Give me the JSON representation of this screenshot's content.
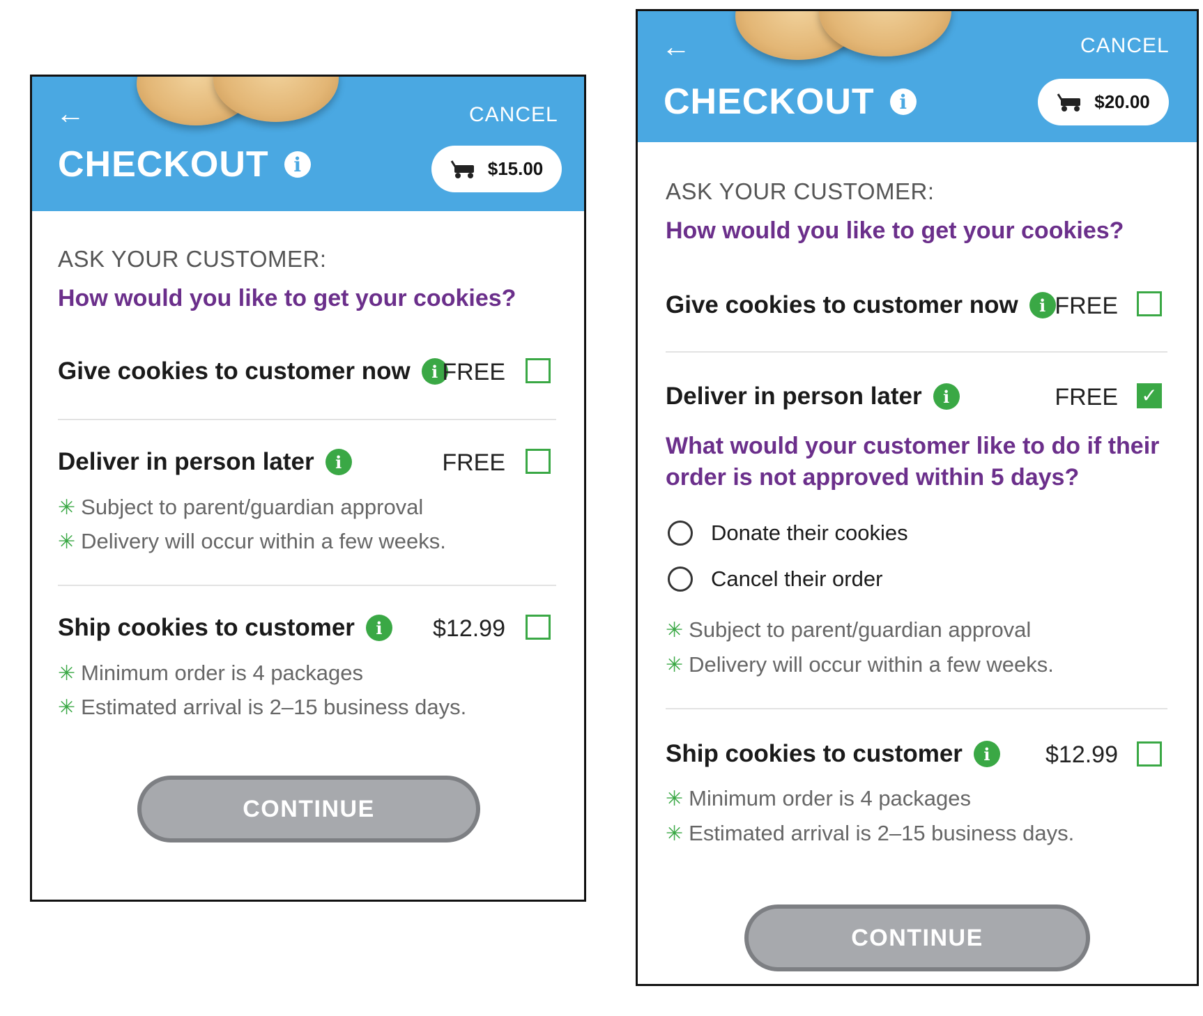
{
  "screens": [
    {
      "header": {
        "back_icon": "arrow-left-icon",
        "cancel_label": "CANCEL",
        "title": "CHECKOUT",
        "info_icon": "info-icon",
        "cart_icon": "wagon-cart-icon",
        "cart_total": "$15.00"
      },
      "ask_label": "ASK YOUR CUSTOMER:",
      "question": "How would you like to get your cookies?",
      "options": [
        {
          "label": "Give cookies to customer now",
          "price": "FREE",
          "checked": false
        },
        {
          "label": "Deliver in person later",
          "price": "FREE",
          "checked": false,
          "notes": [
            "Subject to parent/guardian approval",
            "Delivery will occur within a few weeks."
          ]
        },
        {
          "label": "Ship cookies to customer",
          "price": "$12.99",
          "checked": false,
          "notes": [
            "Minimum order is 4 packages",
            "Estimated arrival is 2–15 business days."
          ]
        }
      ],
      "continue_label": "CONTINUE"
    },
    {
      "header": {
        "back_icon": "arrow-left-icon",
        "cancel_label": "CANCEL",
        "title": "CHECKOUT",
        "info_icon": "info-icon",
        "cart_icon": "wagon-cart-icon",
        "cart_total": "$20.00"
      },
      "ask_label": "ASK YOUR CUSTOMER:",
      "question": "How would you like to get your cookies?",
      "options": [
        {
          "label": "Give cookies to customer now",
          "price": "FREE",
          "checked": false
        },
        {
          "label": "Deliver in person later",
          "price": "FREE",
          "checked": true,
          "follow_up_question": "What would your customer like to do if their order is not approved within 5 days?",
          "choices": [
            "Donate their cookies",
            "Cancel their order"
          ],
          "notes": [
            "Subject to parent/guardian approval",
            "Delivery will occur within a few weeks."
          ]
        },
        {
          "label": "Ship cookies to customer",
          "price": "$12.99",
          "checked": false,
          "notes": [
            "Minimum order is 4 packages",
            "Estimated arrival is 2–15 business days."
          ]
        }
      ],
      "continue_label": "CONTINUE"
    }
  ],
  "colors": {
    "header_blue": "#4aa8e2",
    "accent_green": "#3aa845",
    "question_purple": "#6b2f8b",
    "button_gray": "#a7a9ad"
  }
}
